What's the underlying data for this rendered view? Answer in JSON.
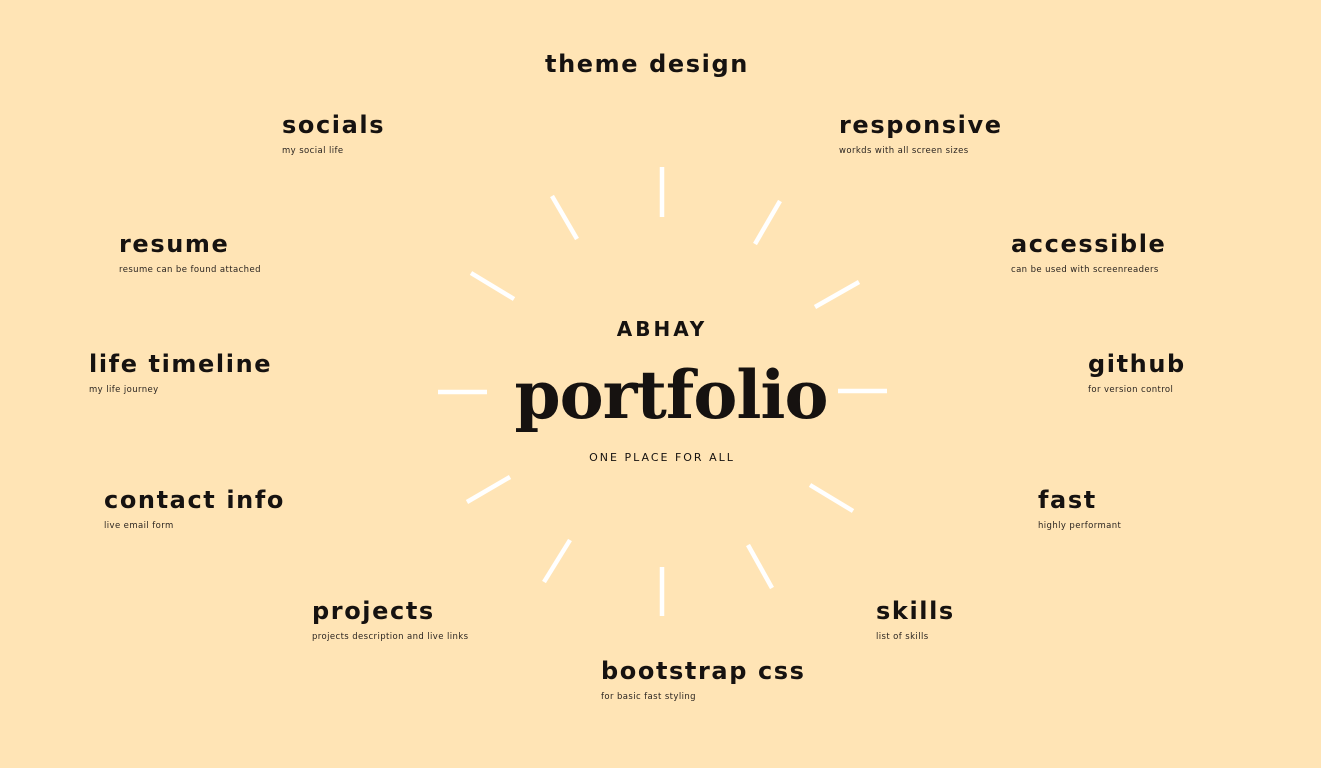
{
  "theme": {
    "background": "#FFE4B5",
    "text": "#161210",
    "ray_color": "#FFFFFF"
  },
  "center": {
    "name": "ABHAY",
    "title": "portfolio",
    "tagline": "ONE PLACE FOR ALL"
  },
  "features": {
    "theme_design": {
      "title": "theme design",
      "desc": ""
    },
    "responsive": {
      "title": "responsive",
      "desc": "workds with all screen sizes"
    },
    "accessible": {
      "title": "accessible",
      "desc": "can be used with screenreaders"
    },
    "github": {
      "title": "github",
      "desc": "for version control"
    },
    "fast": {
      "title": "fast",
      "desc": "highly performant"
    },
    "skills": {
      "title": "skills",
      "desc": "list of skills"
    },
    "bootstrap": {
      "title": "bootstrap css",
      "desc": "for basic fast styling"
    },
    "projects": {
      "title": "projects",
      "desc": "projects description and live links"
    },
    "contact": {
      "title": "contact info",
      "desc": "live email form"
    },
    "timeline": {
      "title": "life timeline",
      "desc": "my life journey"
    },
    "resume": {
      "title": "resume",
      "desc": "resume can be found attached"
    },
    "socials": {
      "title": "socials",
      "desc": "my social life"
    }
  }
}
